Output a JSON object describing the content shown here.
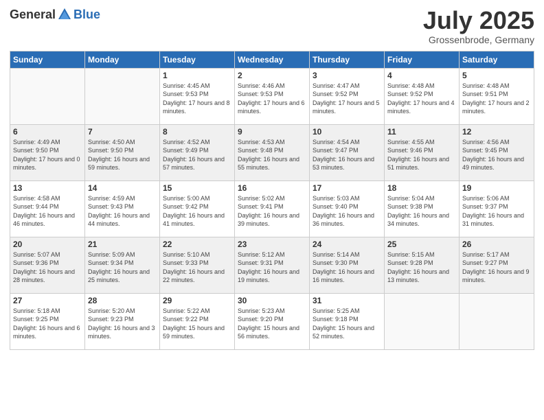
{
  "logo": {
    "general": "General",
    "blue": "Blue"
  },
  "header": {
    "month": "July 2025",
    "location": "Grossenbrode, Germany"
  },
  "weekdays": [
    "Sunday",
    "Monday",
    "Tuesday",
    "Wednesday",
    "Thursday",
    "Friday",
    "Saturday"
  ],
  "weeks": [
    [
      {
        "day": "",
        "info": ""
      },
      {
        "day": "",
        "info": ""
      },
      {
        "day": "1",
        "info": "Sunrise: 4:45 AM\nSunset: 9:53 PM\nDaylight: 17 hours and 8 minutes."
      },
      {
        "day": "2",
        "info": "Sunrise: 4:46 AM\nSunset: 9:53 PM\nDaylight: 17 hours and 6 minutes."
      },
      {
        "day": "3",
        "info": "Sunrise: 4:47 AM\nSunset: 9:52 PM\nDaylight: 17 hours and 5 minutes."
      },
      {
        "day": "4",
        "info": "Sunrise: 4:48 AM\nSunset: 9:52 PM\nDaylight: 17 hours and 4 minutes."
      },
      {
        "day": "5",
        "info": "Sunrise: 4:48 AM\nSunset: 9:51 PM\nDaylight: 17 hours and 2 minutes."
      }
    ],
    [
      {
        "day": "6",
        "info": "Sunrise: 4:49 AM\nSunset: 9:50 PM\nDaylight: 17 hours and 0 minutes."
      },
      {
        "day": "7",
        "info": "Sunrise: 4:50 AM\nSunset: 9:50 PM\nDaylight: 16 hours and 59 minutes."
      },
      {
        "day": "8",
        "info": "Sunrise: 4:52 AM\nSunset: 9:49 PM\nDaylight: 16 hours and 57 minutes."
      },
      {
        "day": "9",
        "info": "Sunrise: 4:53 AM\nSunset: 9:48 PM\nDaylight: 16 hours and 55 minutes."
      },
      {
        "day": "10",
        "info": "Sunrise: 4:54 AM\nSunset: 9:47 PM\nDaylight: 16 hours and 53 minutes."
      },
      {
        "day": "11",
        "info": "Sunrise: 4:55 AM\nSunset: 9:46 PM\nDaylight: 16 hours and 51 minutes."
      },
      {
        "day": "12",
        "info": "Sunrise: 4:56 AM\nSunset: 9:45 PM\nDaylight: 16 hours and 49 minutes."
      }
    ],
    [
      {
        "day": "13",
        "info": "Sunrise: 4:58 AM\nSunset: 9:44 PM\nDaylight: 16 hours and 46 minutes."
      },
      {
        "day": "14",
        "info": "Sunrise: 4:59 AM\nSunset: 9:43 PM\nDaylight: 16 hours and 44 minutes."
      },
      {
        "day": "15",
        "info": "Sunrise: 5:00 AM\nSunset: 9:42 PM\nDaylight: 16 hours and 41 minutes."
      },
      {
        "day": "16",
        "info": "Sunrise: 5:02 AM\nSunset: 9:41 PM\nDaylight: 16 hours and 39 minutes."
      },
      {
        "day": "17",
        "info": "Sunrise: 5:03 AM\nSunset: 9:40 PM\nDaylight: 16 hours and 36 minutes."
      },
      {
        "day": "18",
        "info": "Sunrise: 5:04 AM\nSunset: 9:38 PM\nDaylight: 16 hours and 34 minutes."
      },
      {
        "day": "19",
        "info": "Sunrise: 5:06 AM\nSunset: 9:37 PM\nDaylight: 16 hours and 31 minutes."
      }
    ],
    [
      {
        "day": "20",
        "info": "Sunrise: 5:07 AM\nSunset: 9:36 PM\nDaylight: 16 hours and 28 minutes."
      },
      {
        "day": "21",
        "info": "Sunrise: 5:09 AM\nSunset: 9:34 PM\nDaylight: 16 hours and 25 minutes."
      },
      {
        "day": "22",
        "info": "Sunrise: 5:10 AM\nSunset: 9:33 PM\nDaylight: 16 hours and 22 minutes."
      },
      {
        "day": "23",
        "info": "Sunrise: 5:12 AM\nSunset: 9:31 PM\nDaylight: 16 hours and 19 minutes."
      },
      {
        "day": "24",
        "info": "Sunrise: 5:14 AM\nSunset: 9:30 PM\nDaylight: 16 hours and 16 minutes."
      },
      {
        "day": "25",
        "info": "Sunrise: 5:15 AM\nSunset: 9:28 PM\nDaylight: 16 hours and 13 minutes."
      },
      {
        "day": "26",
        "info": "Sunrise: 5:17 AM\nSunset: 9:27 PM\nDaylight: 16 hours and 9 minutes."
      }
    ],
    [
      {
        "day": "27",
        "info": "Sunrise: 5:18 AM\nSunset: 9:25 PM\nDaylight: 16 hours and 6 minutes."
      },
      {
        "day": "28",
        "info": "Sunrise: 5:20 AM\nSunset: 9:23 PM\nDaylight: 16 hours and 3 minutes."
      },
      {
        "day": "29",
        "info": "Sunrise: 5:22 AM\nSunset: 9:22 PM\nDaylight: 15 hours and 59 minutes."
      },
      {
        "day": "30",
        "info": "Sunrise: 5:23 AM\nSunset: 9:20 PM\nDaylight: 15 hours and 56 minutes."
      },
      {
        "day": "31",
        "info": "Sunrise: 5:25 AM\nSunset: 9:18 PM\nDaylight: 15 hours and 52 minutes."
      },
      {
        "day": "",
        "info": ""
      },
      {
        "day": "",
        "info": ""
      }
    ]
  ]
}
